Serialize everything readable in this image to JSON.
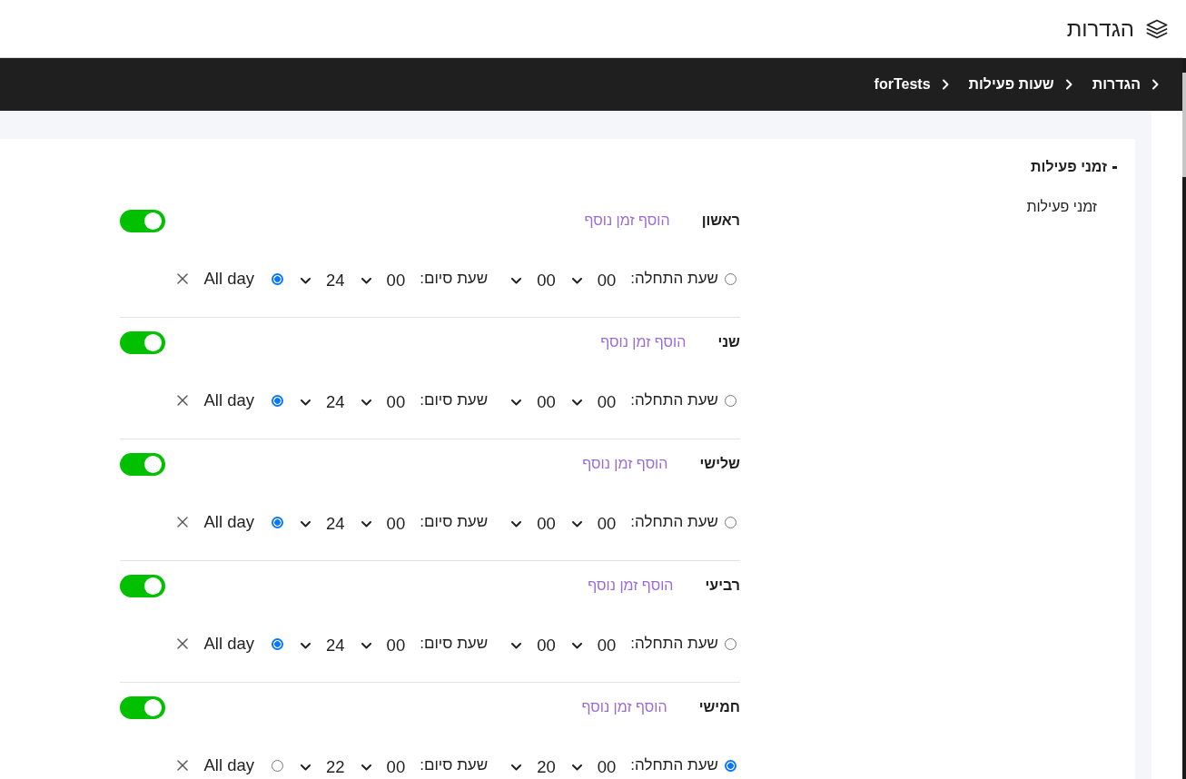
{
  "header": {
    "title": "הגדרות"
  },
  "breadcrumbs": [
    {
      "label": "הגדרות"
    },
    {
      "label": "שעות פעילות"
    },
    {
      "label": "forTests"
    }
  ],
  "sidebar": {
    "items": [
      {
        "label": "זמני פעילות",
        "expanded": true,
        "children": [
          {
            "label": "זמני פעילות"
          }
        ]
      }
    ]
  },
  "days": [
    {
      "name": "ראשון",
      "add_link": "הוסף זמן נוסף",
      "enabled": true,
      "slots": [
        {
          "options": [
            {
              "kind": "range",
              "selected": false,
              "start_label": "שעת התחלה:",
              "start": [
                "00",
                "00"
              ],
              "end_label": "שעת סיום:",
              "end": [
                "00",
                "24"
              ]
            },
            {
              "kind": "all_day",
              "selected": true,
              "label": "All day"
            }
          ]
        }
      ]
    },
    {
      "name": "שני",
      "add_link": "הוסף זמן נוסף",
      "enabled": true,
      "slots": [
        {
          "options": [
            {
              "kind": "range",
              "selected": false,
              "start_label": "שעת התחלה:",
              "start": [
                "00",
                "00"
              ],
              "end_label": "שעת סיום:",
              "end": [
                "00",
                "24"
              ]
            },
            {
              "kind": "all_day",
              "selected": true,
              "label": "All day"
            }
          ]
        }
      ]
    },
    {
      "name": "שלישי",
      "add_link": "הוסף זמן נוסף",
      "enabled": true,
      "slots": [
        {
          "options": [
            {
              "kind": "range",
              "selected": false,
              "start_label": "שעת התחלה:",
              "start": [
                "00",
                "00"
              ],
              "end_label": "שעת סיום:",
              "end": [
                "00",
                "24"
              ]
            },
            {
              "kind": "all_day",
              "selected": true,
              "label": "All day"
            }
          ]
        }
      ]
    },
    {
      "name": "רביעי",
      "add_link": "הוסף זמן נוסף",
      "enabled": true,
      "slots": [
        {
          "options": [
            {
              "kind": "range",
              "selected": false,
              "start_label": "שעת התחלה:",
              "start": [
                "00",
                "00"
              ],
              "end_label": "שעת סיום:",
              "end": [
                "00",
                "24"
              ]
            },
            {
              "kind": "all_day",
              "selected": true,
              "label": "All day"
            }
          ]
        }
      ]
    },
    {
      "name": "חמישי",
      "add_link": "הוסף זמן נוסף",
      "enabled": true,
      "slots": [
        {
          "options": [
            {
              "kind": "range",
              "selected": true,
              "start_label": "שעת התחלה:",
              "start": [
                "00",
                "20"
              ],
              "end_label": "שעת סיום:",
              "end": [
                "00",
                "22"
              ]
            },
            {
              "kind": "all_day",
              "selected": false,
              "label": "All day"
            }
          ]
        }
      ]
    }
  ]
}
